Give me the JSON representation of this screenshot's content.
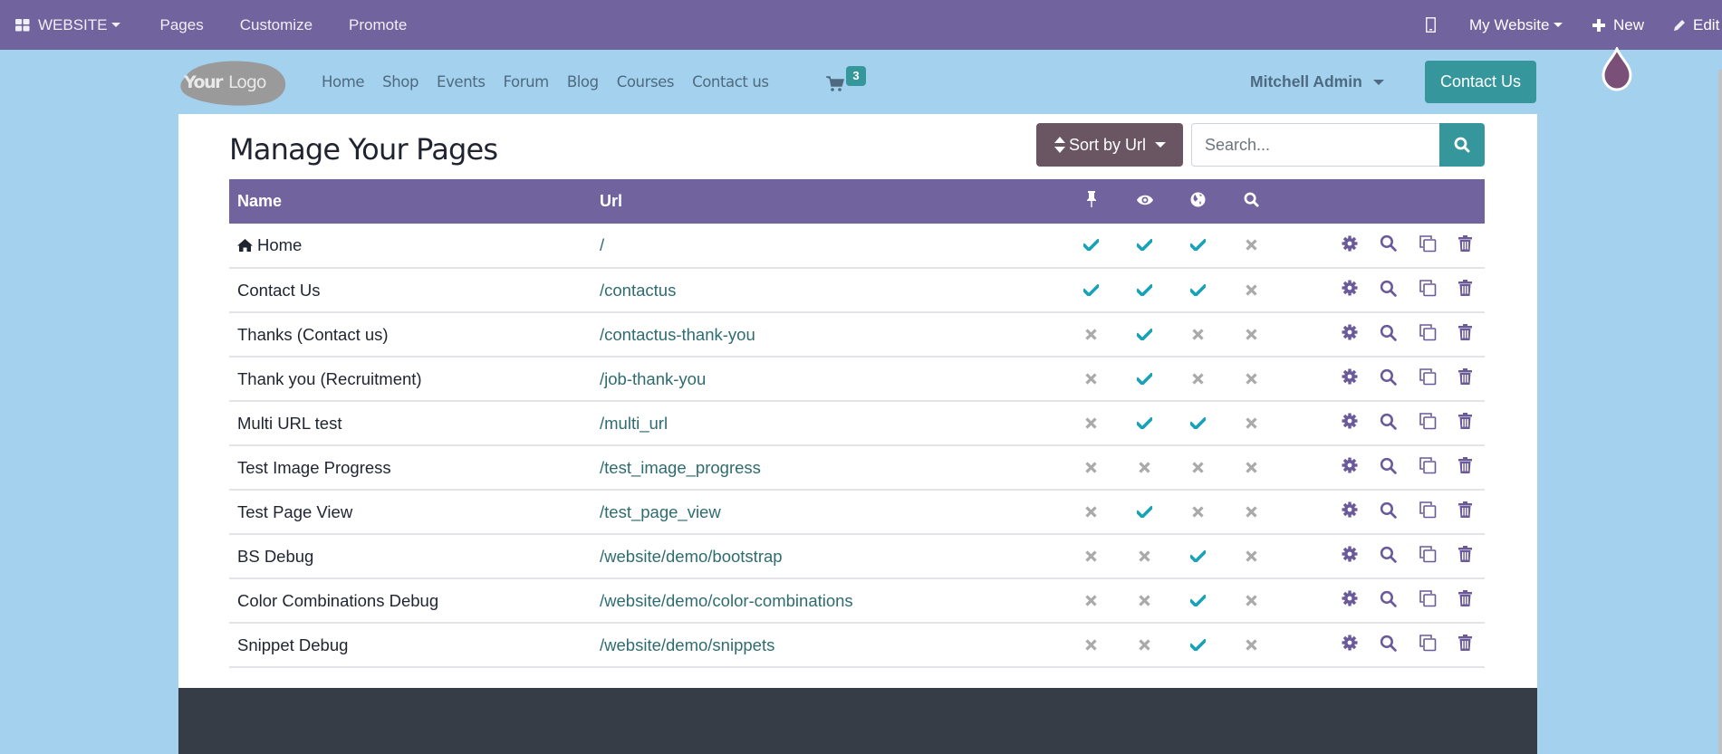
{
  "topbar": {
    "app_label": "WEBSITE",
    "menu": [
      "Pages",
      "Customize",
      "Promote"
    ],
    "right": {
      "website_label": "My Website",
      "new_label": "New",
      "edit_label": "Edit"
    }
  },
  "site_header": {
    "logo_text": "YourLogo",
    "nav": [
      "Home",
      "Shop",
      "Events",
      "Forum",
      "Blog",
      "Courses",
      "Contact us"
    ],
    "cart_count": "3",
    "user_name": "Mitchell Admin",
    "contact_button": "Contact Us"
  },
  "main": {
    "title": "Manage Your Pages",
    "sort_label": "Sort by Url",
    "search_placeholder": "Search...",
    "table": {
      "headers": {
        "name": "Name",
        "url": "Url",
        "icons": [
          "pin-icon",
          "eye-icon",
          "globe-icon",
          "search-icon"
        ]
      },
      "rows": [
        {
          "name": "Home",
          "home_icon": true,
          "url": "/",
          "flags": [
            true,
            true,
            true,
            false
          ]
        },
        {
          "name": "Contact Us",
          "url": "/contactus",
          "flags": [
            true,
            true,
            true,
            false
          ]
        },
        {
          "name": "Thanks (Contact us)",
          "url": "/contactus-thank-you",
          "flags": [
            false,
            true,
            false,
            false
          ]
        },
        {
          "name": "Thank you (Recruitment)",
          "url": "/job-thank-you",
          "flags": [
            false,
            true,
            false,
            false
          ]
        },
        {
          "name": "Multi URL test",
          "url": "/multi_url",
          "flags": [
            false,
            true,
            true,
            false
          ]
        },
        {
          "name": "Test Image Progress",
          "url": "/test_image_progress",
          "flags": [
            false,
            false,
            false,
            false
          ]
        },
        {
          "name": "Test Page View",
          "url": "/test_page_view",
          "flags": [
            false,
            true,
            false,
            false
          ]
        },
        {
          "name": "BS Debug",
          "url": "/website/demo/bootstrap",
          "flags": [
            false,
            false,
            true,
            false
          ]
        },
        {
          "name": "Color Combinations Debug",
          "url": "/website/demo/color-combinations",
          "flags": [
            false,
            false,
            true,
            false
          ]
        },
        {
          "name": "Snippet Debug",
          "url": "/website/demo/snippets",
          "flags": [
            false,
            false,
            true,
            false
          ]
        }
      ],
      "row_actions": [
        "gear-icon",
        "search-icon",
        "clone-icon",
        "trash-icon"
      ]
    }
  },
  "colors": {
    "primary": "#71639e",
    "teal": "#35979c",
    "check": "#17a2b8",
    "cross": "#aaaaaa",
    "sort_button": "#6a5562",
    "site_bg": "#a3d1ee",
    "footer": "#373d46"
  }
}
